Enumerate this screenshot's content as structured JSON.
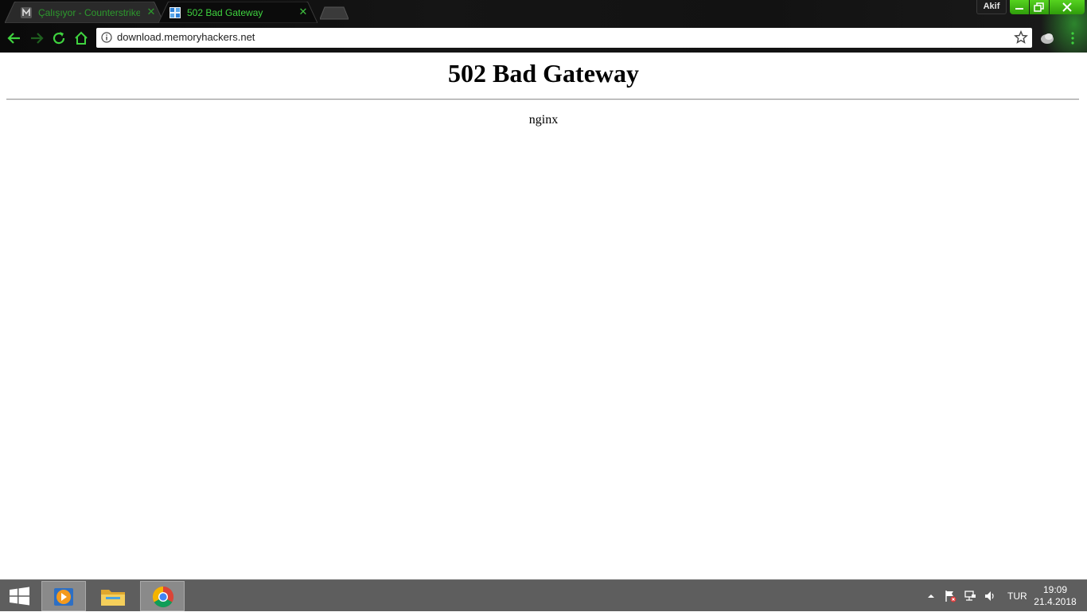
{
  "browser": {
    "tabs": [
      {
        "title": "Çalışıyor - Counterstrike",
        "favicon": "mega-m-icon",
        "active": false
      },
      {
        "title": "502 Bad Gateway",
        "favicon": "site-favicon",
        "active": true
      }
    ],
    "profile_name": "Akif",
    "address": "download.memoryhackers.net",
    "accent_color": "#3fd33f"
  },
  "page": {
    "heading": "502 Bad Gateway",
    "server": "nginx"
  },
  "taskbar": {
    "pinned_apps": [
      "media-player-icon",
      "file-explorer-icon",
      "chrome-icon"
    ],
    "language": "TUR",
    "time": "19:09",
    "date": "21.4.2018"
  }
}
